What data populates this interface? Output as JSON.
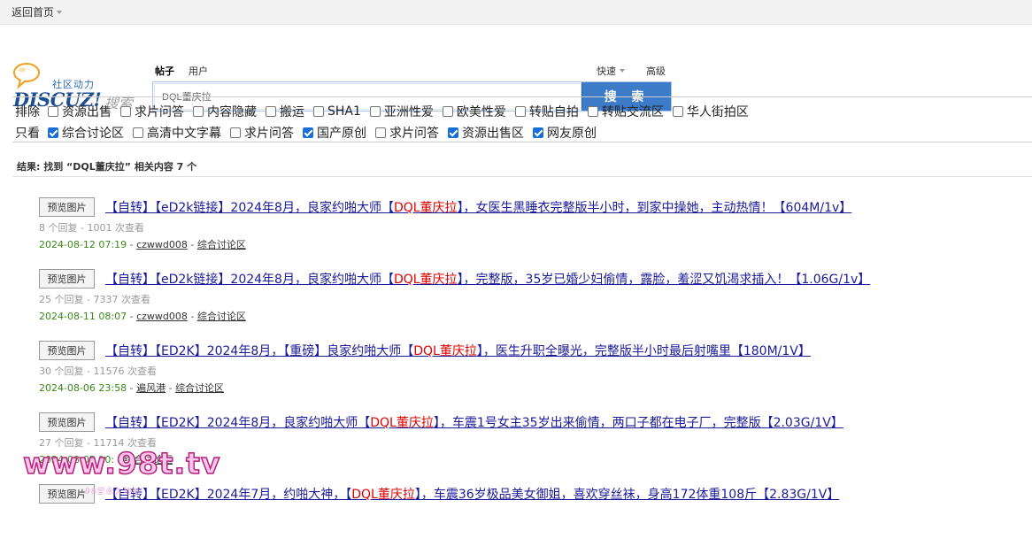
{
  "topbar": {
    "home_label": "返回首页"
  },
  "logo": {
    "tagline": "社区动力",
    "brand": "DISCUZ!",
    "search_word": "搜索"
  },
  "search_types": {
    "posts": "帖子",
    "users": "用户"
  },
  "quick": {
    "fast": "快速",
    "advanced": "高级"
  },
  "search": {
    "value": "DQL董庆拉",
    "button": "搜 索"
  },
  "filters": {
    "exclude_label": "排除",
    "exclude": [
      {
        "label": "资源出售",
        "checked": false
      },
      {
        "label": "求片问答",
        "checked": false
      },
      {
        "label": "内容隐藏",
        "checked": false
      },
      {
        "label": "搬运",
        "checked": false
      },
      {
        "label": "SHA1",
        "checked": false
      },
      {
        "label": "亚洲性爱",
        "checked": false
      },
      {
        "label": "欧美性爱",
        "checked": false
      },
      {
        "label": "转贴自拍",
        "checked": false
      },
      {
        "label": "转贴交流区",
        "checked": false
      },
      {
        "label": "华人街拍区",
        "checked": false
      }
    ],
    "only_label": "只看",
    "only": [
      {
        "label": "综合讨论区",
        "checked": true
      },
      {
        "label": "高清中文字幕",
        "checked": false
      },
      {
        "label": "求片问答",
        "checked": false
      },
      {
        "label": "国产原创",
        "checked": true
      },
      {
        "label": "求片问答",
        "checked": false
      },
      {
        "label": "资源出售区",
        "checked": true
      },
      {
        "label": "网友原创",
        "checked": true
      }
    ]
  },
  "result_text": "结果: 找到 “DQL董庆拉” 相关内容 7 个",
  "preview_label": "预览图片",
  "results": [
    {
      "title_pre": "【自转】【eD2k链接】2024年8月，良家约啪大师【",
      "title_hl": "DQL董庆拉",
      "title_post": "】，女医生黑睡衣完整版半小时，到家中操她，主动热情！【604M/1v】",
      "meta": "8 个回复 - 1001 次查看",
      "date": "2024-08-12 07:19",
      "author": "czwwd008",
      "forum": "综合讨论区"
    },
    {
      "title_pre": "【自转】【eD2k链接】2024年8月，良家约啪大师【",
      "title_hl": "DQL董庆拉",
      "title_post": "】，完整版，35岁已婚少妇偷情，露脸，羞涩又饥渴求插入！【1.06G/1v】",
      "meta": "25 个回复 - 7337 次查看",
      "date": "2024-08-11 08:07",
      "author": "czwwd008",
      "forum": "综合讨论区"
    },
    {
      "title_pre": "【自转】【ED2K】2024年8月，【重磅】良家约啪大师【",
      "title_hl": "DQL董庆拉",
      "title_post": "】，医生升职全曝光，完整版半小时最后射嘴里【180M/1V】",
      "meta": "30 个回复 - 11576 次查看",
      "date": "2024-08-06 23:58",
      "author": "遍风港",
      "forum": "综合讨论区"
    },
    {
      "title_pre": "【自转】【ED2K】2024年8月，良家约啪大师【",
      "title_hl": "DQL董庆拉",
      "title_post": "】，车震1号女主35岁出来偷情，两口子都在电子厂，完整版【2.03G/1V】",
      "meta": "27 个回复 - 11714 次查看",
      "date": "2024-08-05 10:",
      "author": "",
      "forum": "综合讨论区"
    },
    {
      "title_pre": "【自转】【ED2K】2024年7月，约啪大神，【",
      "title_hl": "DQL董庆拉",
      "title_post": "】，车震36岁极品美女御姐，喜欢穿丝袜，身高172体重108斤【2.83G/1V】",
      "meta": "",
      "date": "",
      "author": "",
      "forum": ""
    }
  ],
  "watermark": {
    "text": "www.98t.tv",
    "sub": "98堂永久地址"
  },
  "colors": {
    "accent": "#3c7bc7",
    "link": "#1a1a9a",
    "highlight": "#dd0000",
    "date": "#3a8a1a"
  }
}
